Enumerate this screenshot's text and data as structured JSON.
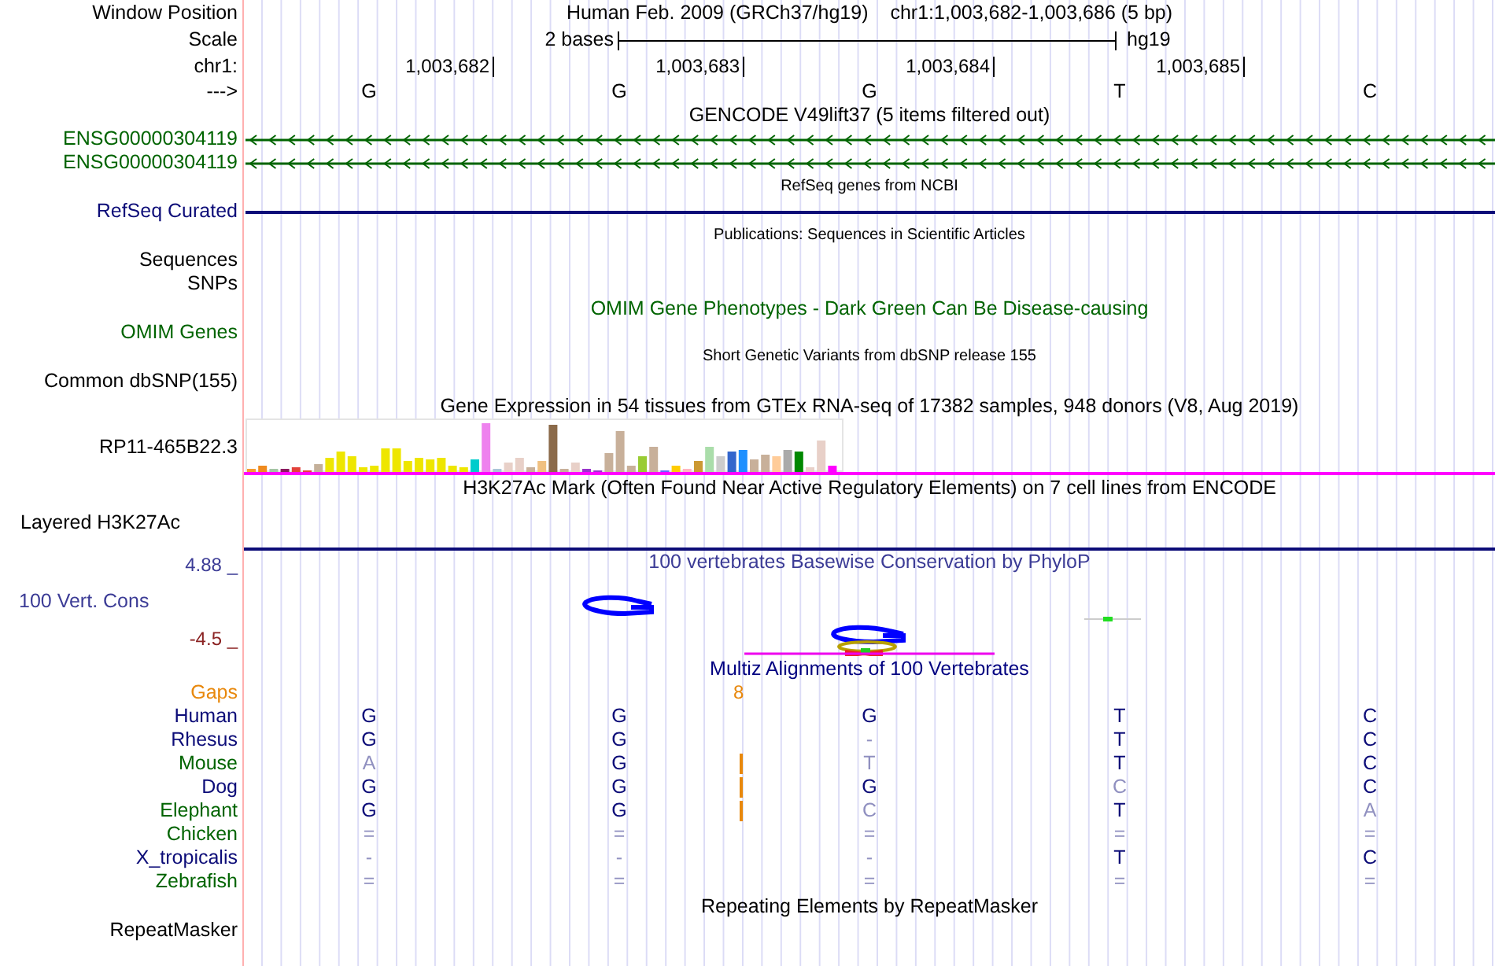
{
  "header": {
    "label": "Window Position",
    "title": "Human Feb. 2009 (GRCh37/hg19)",
    "position": "chr1:1,003,682-1,003,686 (5 bp)"
  },
  "scale": {
    "label": "Scale",
    "span": "2 bases",
    "assembly": "hg19"
  },
  "coordinates": {
    "label": "chr1:",
    "ticks": [
      "1,003,682",
      "1,003,683",
      "1,003,684",
      "1,003,685"
    ]
  },
  "strand": {
    "label": "--->",
    "bases": [
      "G",
      "G",
      "G",
      "T",
      "C"
    ]
  },
  "tracks": [
    {
      "kind": "title",
      "title": "GENCODE V49lift37 (5 items filtered out)",
      "color": "#000000"
    },
    {
      "kind": "gene",
      "label": "ENSG00000304119",
      "color": "#006400"
    },
    {
      "kind": "gene",
      "label": "ENSG00000304119",
      "color": "#006400"
    },
    {
      "kind": "small_title",
      "title": "RefSeq genes from NCBI",
      "color": "#000000"
    },
    {
      "kind": "line",
      "label": "RefSeq Curated",
      "color": "#0c0c78"
    },
    {
      "kind": "small_title",
      "title": "Publications: Sequences in Scientific Articles",
      "color": "#000000"
    },
    {
      "kind": "label",
      "label": "Sequences",
      "color": "#000000"
    },
    {
      "kind": "label",
      "label": "SNPs",
      "color": "#000000"
    },
    {
      "kind": "title",
      "title": "OMIM Gene Phenotypes - Dark Green Can Be Disease-causing",
      "color": "#006400"
    },
    {
      "kind": "label",
      "label": "OMIM Genes",
      "color": "#006400"
    },
    {
      "kind": "small_title",
      "title": "Short Genetic Variants from dbSNP release 155",
      "color": "#000000"
    },
    {
      "kind": "label",
      "label": "Common dbSNP(155)",
      "color": "#000000"
    },
    {
      "kind": "title",
      "title": "Gene Expression in 54 tissues from GTEx RNA-seq of 17382 samples, 948 donors (V8, Aug 2019)",
      "color": "#000000"
    },
    {
      "kind": "expression",
      "label": "RP11-465B22.3",
      "color": "#000000"
    },
    {
      "kind": "title",
      "title": "H3K27Ac Mark (Often Found Near Active Regulatory Elements) on 7 cell lines from ENCODE",
      "color": "#000000"
    },
    {
      "kind": "layered",
      "label": "Layered H3K27Ac",
      "color": "#000000"
    },
    {
      "kind": "conservation",
      "top": "4.88 _",
      "label": "100 Vert. Cons",
      "bottom": "-4.5 _",
      "title": "100 vertebrates Basewise Conservation by PhyloP",
      "color": "#3c3c96"
    },
    {
      "kind": "title",
      "title": "Multiz Alignments of 100 Vertebrates",
      "color": "#000080"
    },
    {
      "kind": "gaps",
      "label": "Gaps",
      "count": "8",
      "color": "#e8880c"
    },
    {
      "kind": "species",
      "label": "Human",
      "color": "#0c0c78",
      "insertion": false,
      "bases": [
        {
          "base": "G",
          "match": true
        },
        {
          "base": "G",
          "match": true
        },
        {
          "base": "G",
          "match": true
        },
        {
          "base": "T",
          "match": true
        },
        {
          "base": "C",
          "match": true
        }
      ]
    },
    {
      "kind": "species",
      "label": "Rhesus",
      "color": "#0c0c78",
      "insertion": false,
      "bases": [
        {
          "base": "G",
          "match": true
        },
        {
          "base": "G",
          "match": true
        },
        {
          "base": "-",
          "match": false
        },
        {
          "base": "T",
          "match": true
        },
        {
          "base": "C",
          "match": true
        }
      ]
    },
    {
      "kind": "species",
      "label": "Mouse",
      "color": "#006400",
      "insertion": true,
      "bases": [
        {
          "base": "A",
          "match": false
        },
        {
          "base": "G",
          "match": true
        },
        {
          "base": "T",
          "match": false
        },
        {
          "base": "T",
          "match": true
        },
        {
          "base": "C",
          "match": true
        }
      ]
    },
    {
      "kind": "species",
      "label": "Dog",
      "color": "#0c0c78",
      "insertion": true,
      "bases": [
        {
          "base": "G",
          "match": true
        },
        {
          "base": "G",
          "match": true
        },
        {
          "base": "G",
          "match": true
        },
        {
          "base": "C",
          "match": false
        },
        {
          "base": "C",
          "match": true
        }
      ]
    },
    {
      "kind": "species",
      "label": "Elephant",
      "color": "#006400",
      "insertion": true,
      "bases": [
        {
          "base": "G",
          "match": true
        },
        {
          "base": "G",
          "match": true
        },
        {
          "base": "C",
          "match": false
        },
        {
          "base": "T",
          "match": true
        },
        {
          "base": "A",
          "match": false
        }
      ]
    },
    {
      "kind": "species",
      "label": "Chicken",
      "color": "#006400",
      "insertion": false,
      "bases": [
        {
          "base": "=",
          "match": false
        },
        {
          "base": "=",
          "match": false
        },
        {
          "base": "=",
          "match": false
        },
        {
          "base": "=",
          "match": false
        },
        {
          "base": "=",
          "match": false
        }
      ]
    },
    {
      "kind": "species",
      "label": "X_tropicalis",
      "color": "#0c0c78",
      "insertion": false,
      "bases": [
        {
          "base": "-",
          "match": false
        },
        {
          "base": "-",
          "match": false
        },
        {
          "base": "-",
          "match": false
        },
        {
          "base": "T",
          "match": true
        },
        {
          "base": "C",
          "match": true
        }
      ]
    },
    {
      "kind": "species",
      "label": "Zebrafish",
      "color": "#006400",
      "insertion": false,
      "bases": [
        {
          "base": "=",
          "match": false
        },
        {
          "base": "=",
          "match": false
        },
        {
          "base": "=",
          "match": false
        },
        {
          "base": "=",
          "match": false
        },
        {
          "base": "=",
          "match": false
        }
      ]
    },
    {
      "kind": "title",
      "title": "Repeating Elements by RepeatMasker",
      "color": "#000000"
    },
    {
      "kind": "label",
      "label": "RepeatMasker",
      "color": "#000000"
    }
  ]
}
